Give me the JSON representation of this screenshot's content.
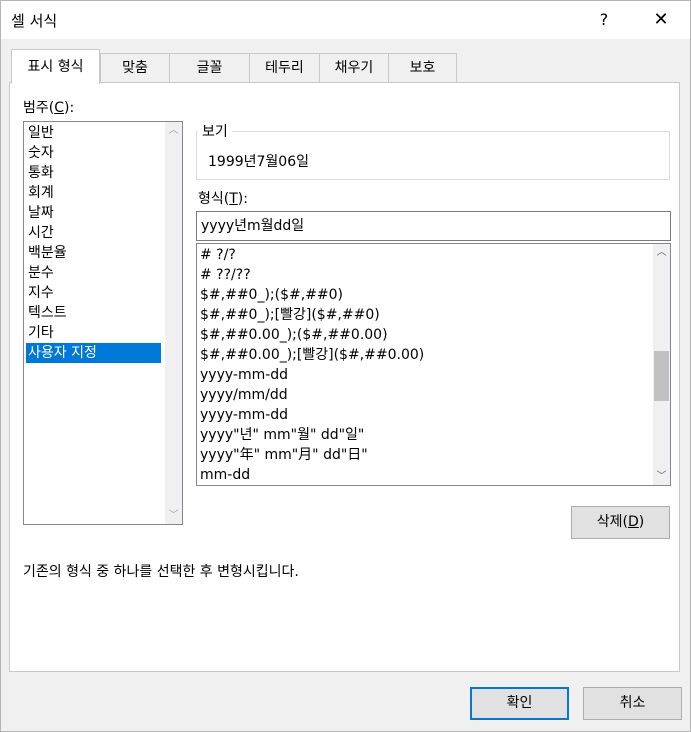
{
  "window": {
    "title": "셀 서식",
    "help": "?",
    "close": "✕"
  },
  "tabs": [
    {
      "label": "표시 형식"
    },
    {
      "label": "맞춤"
    },
    {
      "label": "글꼴"
    },
    {
      "label": "테두리"
    },
    {
      "label": "채우기"
    },
    {
      "label": "보호"
    }
  ],
  "category": {
    "label_prefix": "범주(",
    "label_key": "C",
    "label_suffix": "):",
    "items": [
      "일반",
      "숫자",
      "통화",
      "회계",
      "날짜",
      "시간",
      "백분율",
      "분수",
      "지수",
      "텍스트",
      "기타",
      "사용자 지정"
    ],
    "selected": "사용자 지정"
  },
  "preview": {
    "label": "보기",
    "value": "1999년7월06일"
  },
  "format": {
    "label_prefix": "형식(",
    "label_key": "T",
    "label_suffix": "):",
    "value": "yyyy년m월dd일",
    "items": [
      "# ?/?",
      "# ??/??",
      "$#,##0_);($#,##0)",
      "$#,##0_);[빨강]($#,##0)",
      "$#,##0.00_);($#,##0.00)",
      "$#,##0.00_);[빨강]($#,##0.00)",
      "yyyy-mm-dd",
      "yyyy/mm/dd",
      "yyyy-mm-dd",
      "yyyy\"년\" mm\"월\" dd\"일\"",
      "yyyy\"年\" mm\"月\" dd\"日\"",
      "mm-dd"
    ]
  },
  "delete_button": {
    "label_prefix": "삭제(",
    "label_key": "D",
    "label_suffix": ")"
  },
  "hint": "기존의 형식 중 하나를 선택한 후 변형시킵니다.",
  "ok_button": {
    "label": "확인"
  },
  "cancel_button": {
    "label": "취소"
  },
  "icons": {
    "up": "chevron-up-icon",
    "down": "chevron-down-icon"
  }
}
